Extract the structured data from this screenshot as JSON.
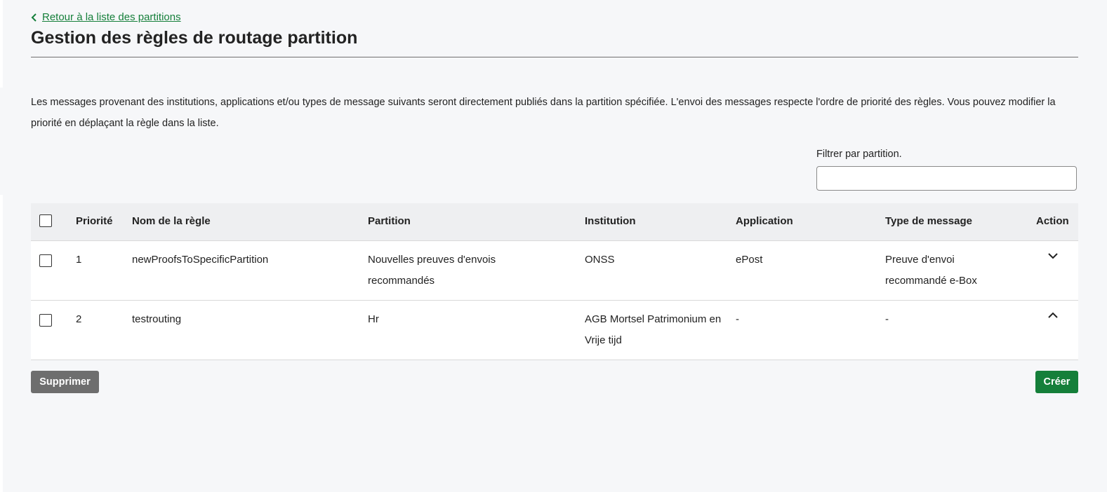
{
  "header": {
    "back_link": "Retour à la liste des partitions",
    "title": "Gestion des règles de routage partition"
  },
  "intro": {
    "text": "Les messages provenant des institutions, applications et/ou types de message suivants seront directement publiés dans la partition spécifiée. L'envoi des messages respecte l'ordre de priorité des règles. Vous pouvez modifier la priorité en déplaçant la règle dans la liste."
  },
  "filter": {
    "label": "Filtrer par partition.",
    "value": "",
    "placeholder": ""
  },
  "table": {
    "columns": [
      "Priorité",
      "Nom de la règle",
      "Partition",
      "Institution",
      "Application",
      "Type de message",
      "Action"
    ],
    "rows": [
      {
        "priority": "1",
        "name": "newProofsToSpecificPartition",
        "partition": "Nouvelles preuves d'envois recommandés",
        "institution": "ONSS",
        "application": "ePost",
        "message_type": "Preuve d'envoi recommandé e-Box",
        "action_icon": "chevron-down-icon"
      },
      {
        "priority": "2",
        "name": "testrouting",
        "partition": "Hr",
        "institution": "AGB Mortsel Patrimonium en Vrije tijd",
        "application": "-",
        "message_type": "-",
        "action_icon": "chevron-up-icon"
      }
    ]
  },
  "buttons": {
    "delete": "Supprimer",
    "create": "Créer"
  },
  "colors": {
    "accent_green": "#157f3a",
    "delete_gray": "#6e6e6e",
    "background": "#f6f7f9"
  }
}
